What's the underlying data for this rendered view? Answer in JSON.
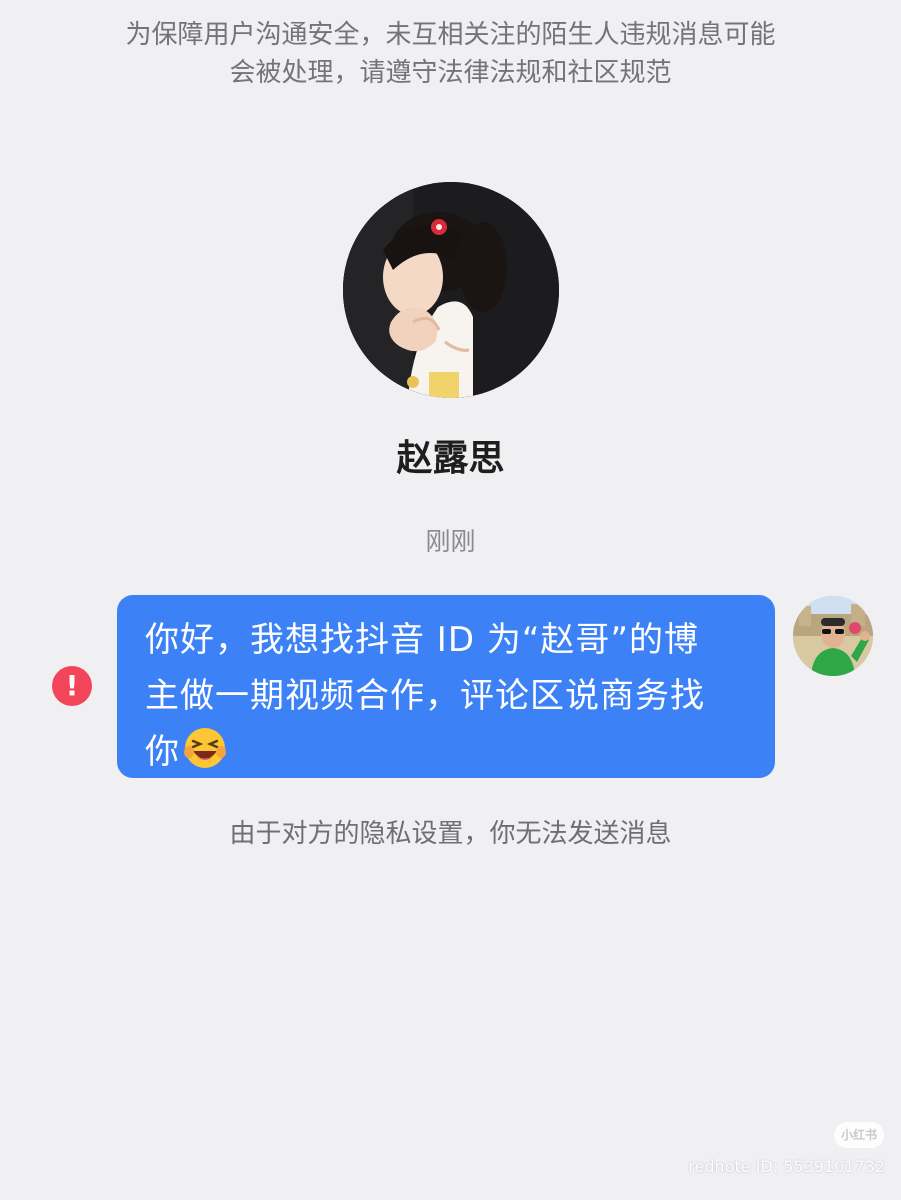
{
  "notice": {
    "line1": "为保障用户沟通安全，未互相关注的陌生人违规消息可能",
    "line2": "会被处理，请遵守法律法规和社区规范"
  },
  "contact": {
    "name": "赵露思",
    "avatar": "girl-photo-avatar"
  },
  "timestamp": "刚刚",
  "message": {
    "text_line1": "你好，我想找抖音 ID 为“赵哥”的博",
    "text_line2": "主做一期视频合作，评论区说商务找",
    "text_line3": "你",
    "emoji": "grinning-squinting-face-emoji",
    "bubble_color": "#3c82f6",
    "status": "send-failed",
    "status_icon_glyph": "!",
    "status_color": "#f2455a"
  },
  "self_avatar": "man-with-sunglasses-avatar",
  "system_message": "由于对方的隐私设置，你无法发送消息",
  "watermark": {
    "logo": "小红书",
    "text": "rednote ID: 5539101732"
  }
}
